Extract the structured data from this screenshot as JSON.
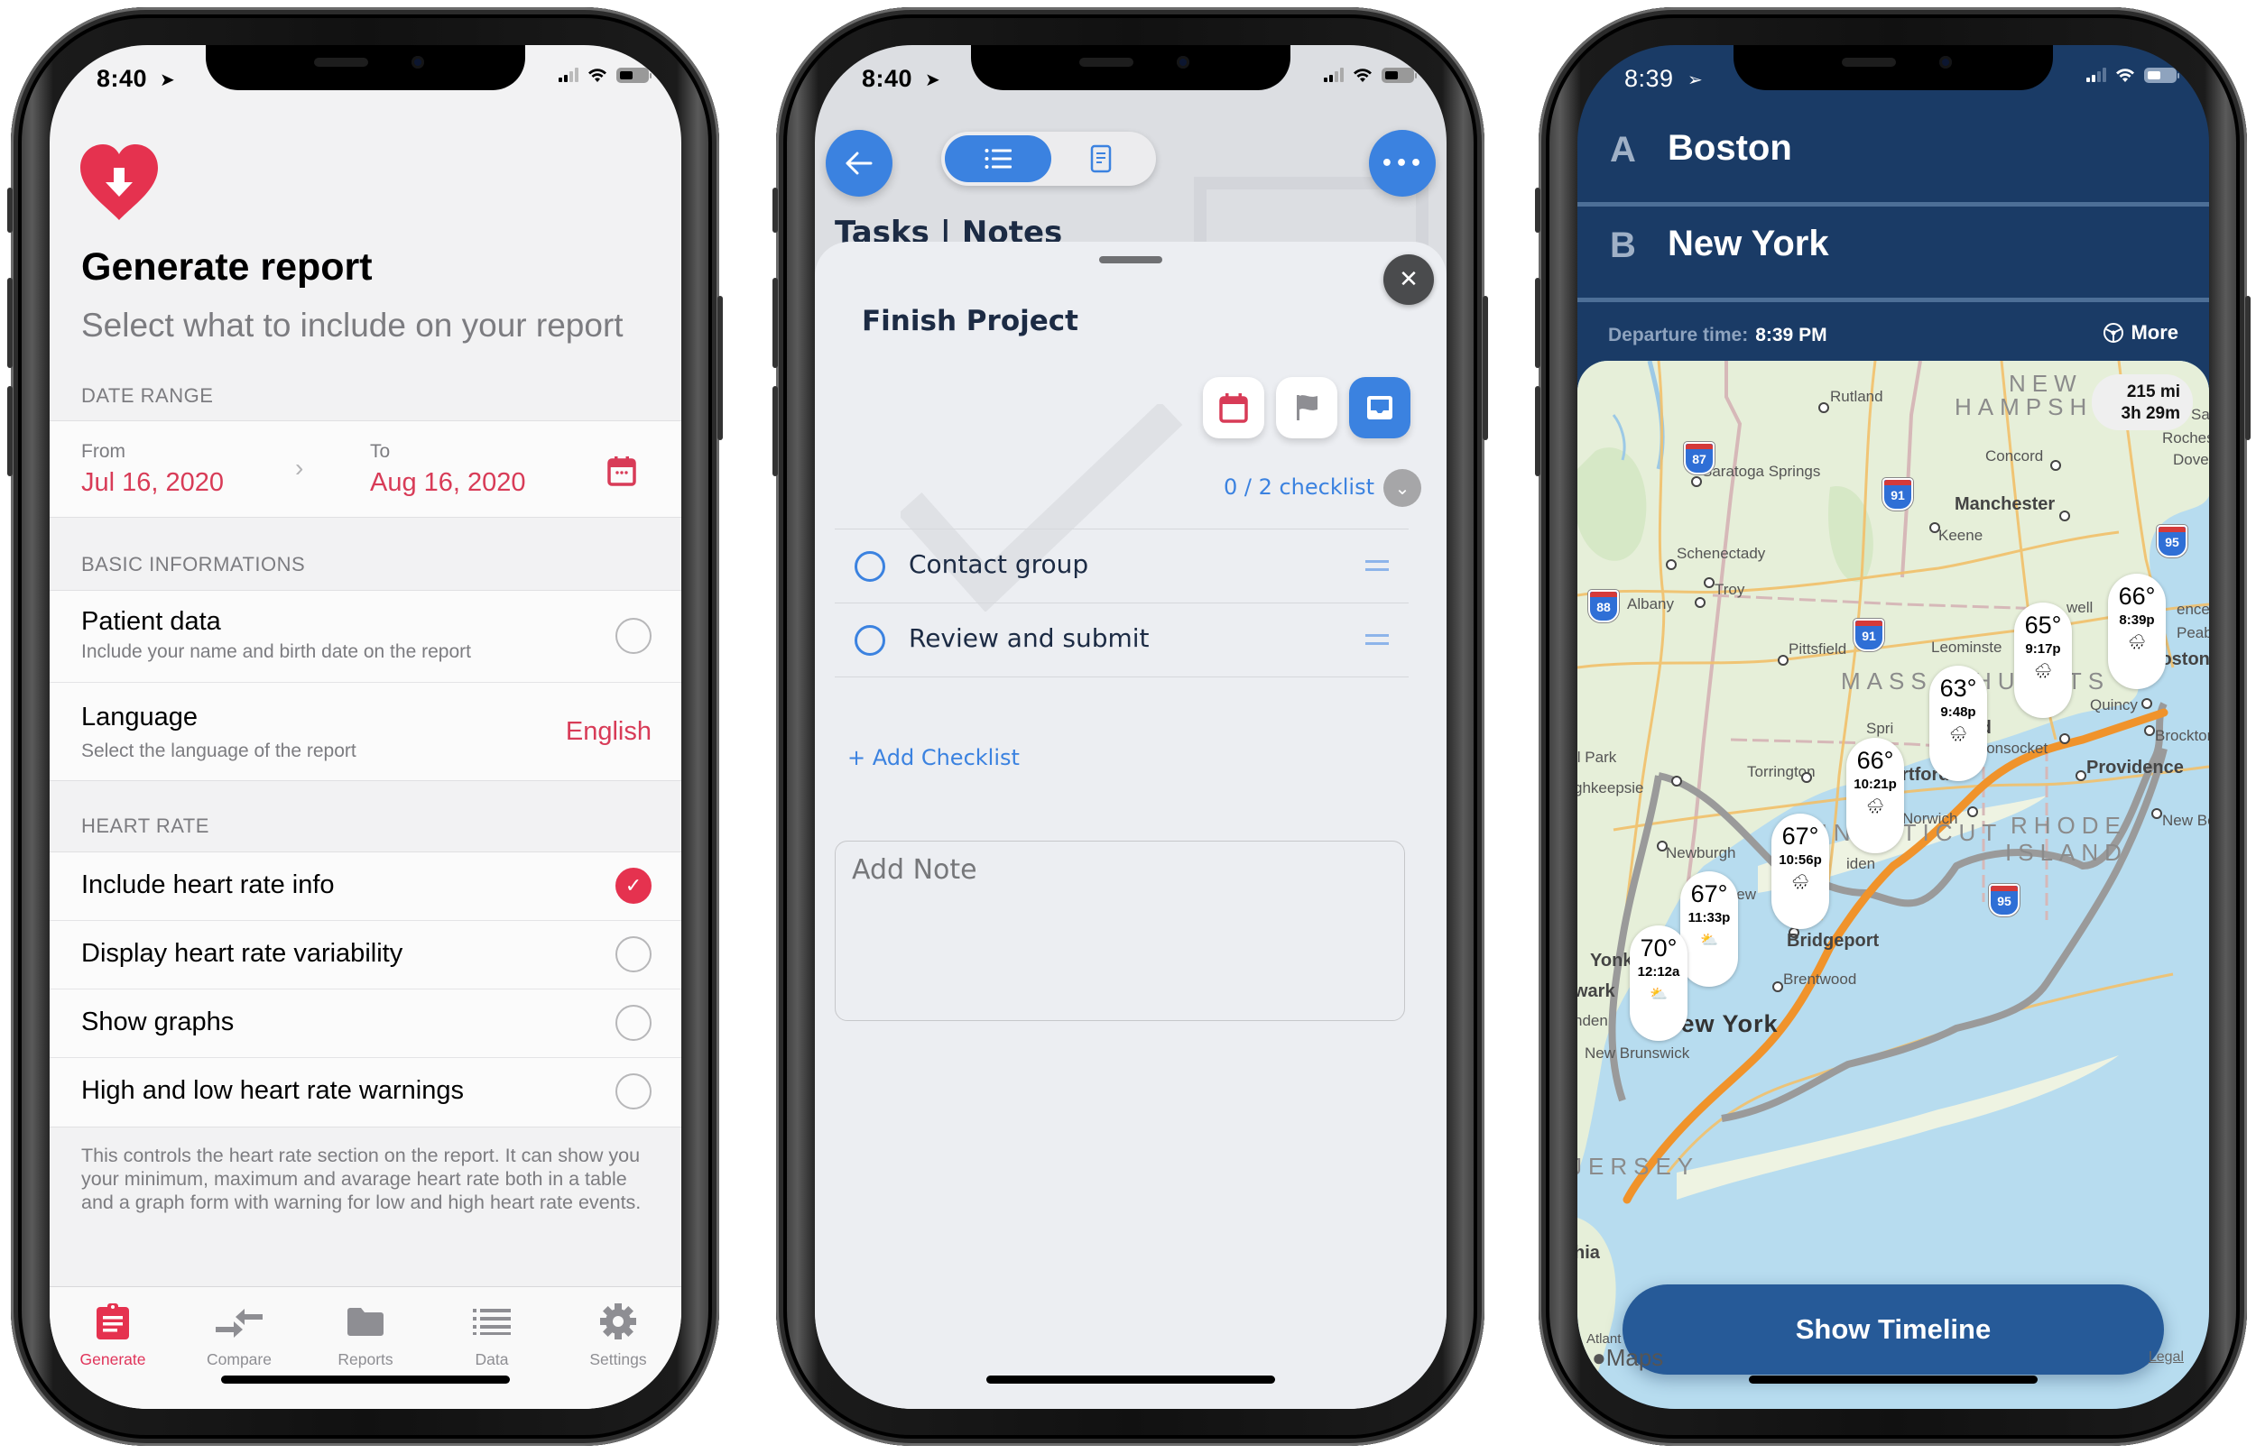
{
  "phones": {
    "report_app": {
      "status": {
        "time": "8:40",
        "location_glyph": "➤"
      },
      "logo_icon": "heart-download-icon",
      "title": "Generate report",
      "subtitle": "Select what to include on your report",
      "sections": {
        "date_range": "DATE RANGE",
        "basic": "BASIC INFORMATIONS",
        "heart_rate": "HEART RATE"
      },
      "date_range": {
        "from_label": "From",
        "from_value": "Jul 16, 2020",
        "to_label": "To",
        "to_value": "Aug 16, 2020"
      },
      "basic": {
        "patient": {
          "label": "Patient data",
          "desc": "Include your name and birth date on the report",
          "checked": false
        },
        "language": {
          "label": "Language",
          "desc": "Select the language of the report",
          "value": "English"
        }
      },
      "heart_rate_options": [
        {
          "label": "Include heart rate info",
          "checked": true
        },
        {
          "label": "Display heart rate variability",
          "checked": false
        },
        {
          "label": "Show graphs",
          "checked": false
        },
        {
          "label": "High and low heart rate warnings",
          "checked": false
        }
      ],
      "footer_note": "This controls the heart rate section on the report. It can show you your minimum, maximum and avarage heart rate both in a table and a graph form with warning for low and high heart rate events.",
      "tabs": [
        {
          "label": "Generate",
          "icon": "clipboard-icon",
          "active": true
        },
        {
          "label": "Compare",
          "icon": "compare-arrows-icon",
          "active": false
        },
        {
          "label": "Reports",
          "icon": "folder-icon",
          "active": false
        },
        {
          "label": "Data",
          "icon": "list-icon",
          "active": false
        },
        {
          "label": "Settings",
          "icon": "gear-icon",
          "active": false
        }
      ],
      "colors": {
        "accent": "#e5324f",
        "background": "#f2f2f3"
      }
    },
    "tasks_app": {
      "status": {
        "time": "8:40",
        "location_glyph": "➤"
      },
      "background_title": "Tasks | Notes",
      "segments": [
        {
          "icon": "list-icon",
          "active": true
        },
        {
          "icon": "note-icon",
          "active": false
        }
      ],
      "task_title": "Finish Project",
      "checklist_count": "0 / 2 checklist",
      "checklist": [
        {
          "label": "Contact group",
          "done": false
        },
        {
          "label": "Review and submit",
          "done": false
        }
      ],
      "add_checklist": "+ Add Checklist",
      "note_placeholder": "Add Note",
      "close_glyph": "✕",
      "colors": {
        "accent": "#3b82e0",
        "calendar": "#d83b57"
      }
    },
    "weather_route_app": {
      "status": {
        "time": "8:39",
        "location_glyph": "➢"
      },
      "origin": {
        "letter": "A",
        "city": "Boston"
      },
      "destination": {
        "letter": "B",
        "city": "New York"
      },
      "departure_label": "Departure time:",
      "departure_value": "8:39 PM",
      "more_label": "More",
      "distance": "215 mi",
      "duration": "3h 29m",
      "weather_stops": [
        {
          "temp": "66°",
          "time": "8:39p",
          "condition": "rain"
        },
        {
          "temp": "65°",
          "time": "9:17p",
          "condition": "rain"
        },
        {
          "temp": "63°",
          "time": "9:48p",
          "condition": "rain"
        },
        {
          "temp": "66°",
          "time": "10:21p",
          "condition": "rain"
        },
        {
          "temp": "67°",
          "time": "10:56p",
          "condition": "rain"
        },
        {
          "temp": "67°",
          "time": "11:33p",
          "condition": "partly-cloudy"
        },
        {
          "temp": "70°",
          "time": "12:12a",
          "condition": "partly-cloudy"
        }
      ],
      "map_labels": {
        "states": [
          "NEW",
          "HAMPSHI",
          "MASS",
          "HU",
          "TTS",
          "NNECTICUT",
          "RHODE",
          "ISLAND",
          "JERSEY"
        ],
        "cities": [
          "Rutland",
          "Saratoga Springs",
          "Concord",
          "Manchester",
          "Keene",
          "Schenectady",
          "Troy",
          "Albany",
          "Pittsfield",
          "Leominste",
          "Boston",
          "Quincy",
          "Brockton",
          "Woonsocket",
          "Providence",
          "Torrington",
          "artford",
          "Norwich",
          "New Bo",
          "ghkeepsie",
          "Newburgh",
          "New",
          "Bridgeport",
          "Brentwood",
          "New York",
          "wark",
          "nden",
          "New Brunswick",
          "hia",
          "Atlant",
          "Roches",
          "Dove",
          "Sa",
          "Peabo",
          "ence",
          "well",
          "Spri",
          "eld",
          "iden",
          "ll Park",
          "Yonk"
        ],
        "highways": [
          "87",
          "91",
          "91",
          "95",
          "88",
          "95"
        ]
      },
      "show_timeline": "Show Timeline",
      "maps_attribution": "Maps",
      "legal": "Legal",
      "colors": {
        "header": "#1a3b66",
        "button": "#265a98",
        "route_primary": "#f0932b",
        "route_alt": "#9a9a9a",
        "water": "#b7dcef",
        "land": "#e8f0dc"
      }
    }
  }
}
